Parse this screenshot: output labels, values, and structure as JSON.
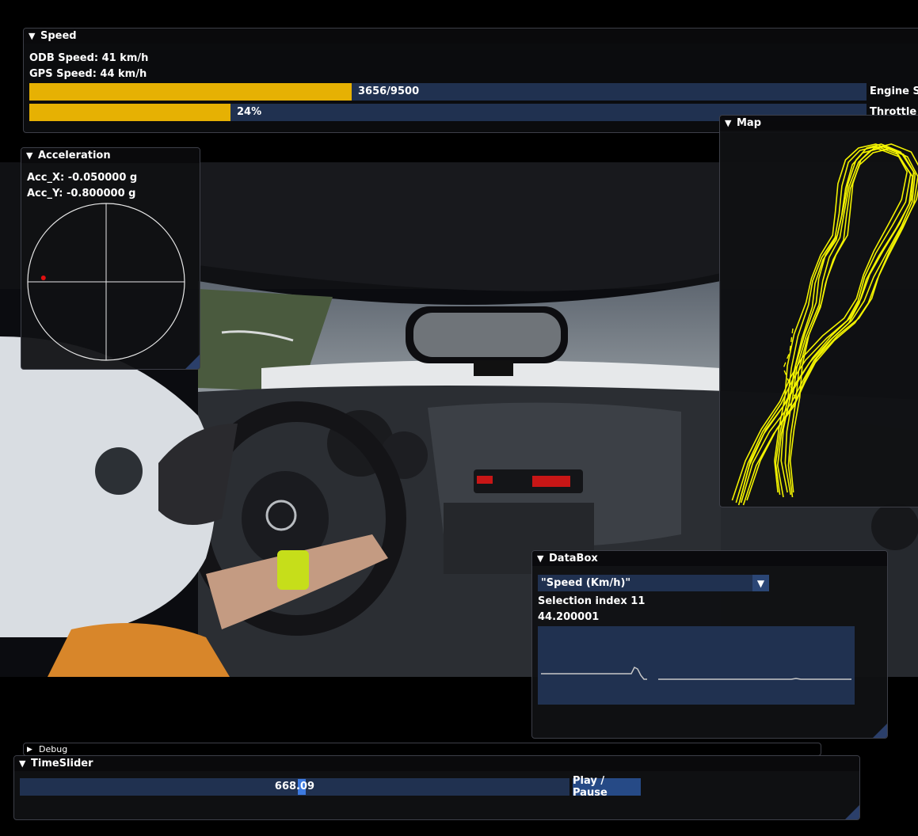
{
  "speed": {
    "title": "Speed",
    "odb": "ODB Speed: 41 km/h",
    "gps": "GPS Speed: 44 km/h",
    "engine": {
      "text": "3656/9500",
      "fraction": 0.385,
      "label": "Engine Sp"
    },
    "throttle": {
      "text": "24%",
      "fraction": 0.24,
      "label": "Throttle P"
    }
  },
  "acceleration": {
    "title": "Acceleration",
    "acc_x": "Acc_X: -0.050000 g",
    "acc_y": "Acc_Y: -0.800000 g",
    "x_g": -0.05,
    "y_g": -0.8,
    "dot_color": "#e01010"
  },
  "map": {
    "title": "Map",
    "track_color": "#f2f200"
  },
  "databox": {
    "title": "DataBox",
    "selected": "\"Speed (Km/h)\"",
    "selection": "Selection index 11",
    "value": "44.200001"
  },
  "debug": {
    "title": "Debug"
  },
  "timeslider": {
    "title": "TimeSlider",
    "value": "668.09",
    "play_label": "Play / Pause"
  },
  "colors": {
    "accent_bar": "#e6b103",
    "frame_bg": "#203150",
    "button": "#264a86"
  }
}
